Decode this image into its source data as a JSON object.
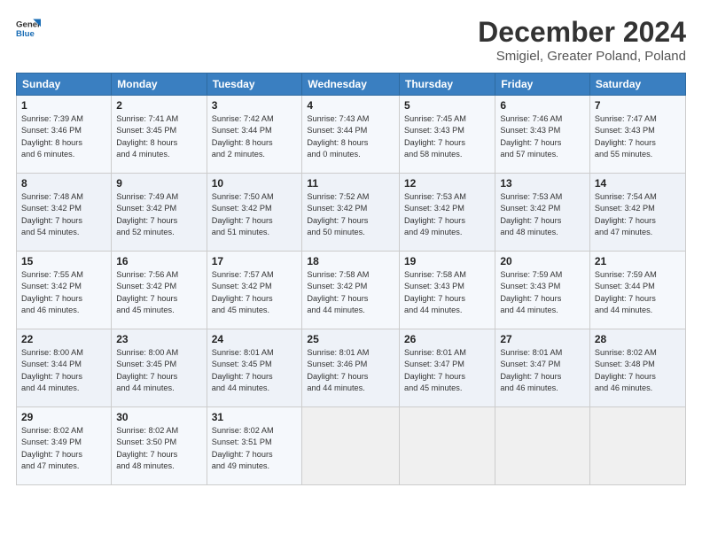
{
  "header": {
    "logo_line1": "General",
    "logo_line2": "Blue",
    "title": "December 2024",
    "subtitle": "Smigiel, Greater Poland, Poland"
  },
  "columns": [
    "Sunday",
    "Monday",
    "Tuesday",
    "Wednesday",
    "Thursday",
    "Friday",
    "Saturday"
  ],
  "weeks": [
    [
      {
        "day": "1",
        "info": "Sunrise: 7:39 AM\nSunset: 3:46 PM\nDaylight: 8 hours\nand 6 minutes."
      },
      {
        "day": "2",
        "info": "Sunrise: 7:41 AM\nSunset: 3:45 PM\nDaylight: 8 hours\nand 4 minutes."
      },
      {
        "day": "3",
        "info": "Sunrise: 7:42 AM\nSunset: 3:44 PM\nDaylight: 8 hours\nand 2 minutes."
      },
      {
        "day": "4",
        "info": "Sunrise: 7:43 AM\nSunset: 3:44 PM\nDaylight: 8 hours\nand 0 minutes."
      },
      {
        "day": "5",
        "info": "Sunrise: 7:45 AM\nSunset: 3:43 PM\nDaylight: 7 hours\nand 58 minutes."
      },
      {
        "day": "6",
        "info": "Sunrise: 7:46 AM\nSunset: 3:43 PM\nDaylight: 7 hours\nand 57 minutes."
      },
      {
        "day": "7",
        "info": "Sunrise: 7:47 AM\nSunset: 3:43 PM\nDaylight: 7 hours\nand 55 minutes."
      }
    ],
    [
      {
        "day": "8",
        "info": "Sunrise: 7:48 AM\nSunset: 3:42 PM\nDaylight: 7 hours\nand 54 minutes."
      },
      {
        "day": "9",
        "info": "Sunrise: 7:49 AM\nSunset: 3:42 PM\nDaylight: 7 hours\nand 52 minutes."
      },
      {
        "day": "10",
        "info": "Sunrise: 7:50 AM\nSunset: 3:42 PM\nDaylight: 7 hours\nand 51 minutes."
      },
      {
        "day": "11",
        "info": "Sunrise: 7:52 AM\nSunset: 3:42 PM\nDaylight: 7 hours\nand 50 minutes."
      },
      {
        "day": "12",
        "info": "Sunrise: 7:53 AM\nSunset: 3:42 PM\nDaylight: 7 hours\nand 49 minutes."
      },
      {
        "day": "13",
        "info": "Sunrise: 7:53 AM\nSunset: 3:42 PM\nDaylight: 7 hours\nand 48 minutes."
      },
      {
        "day": "14",
        "info": "Sunrise: 7:54 AM\nSunset: 3:42 PM\nDaylight: 7 hours\nand 47 minutes."
      }
    ],
    [
      {
        "day": "15",
        "info": "Sunrise: 7:55 AM\nSunset: 3:42 PM\nDaylight: 7 hours\nand 46 minutes."
      },
      {
        "day": "16",
        "info": "Sunrise: 7:56 AM\nSunset: 3:42 PM\nDaylight: 7 hours\nand 45 minutes."
      },
      {
        "day": "17",
        "info": "Sunrise: 7:57 AM\nSunset: 3:42 PM\nDaylight: 7 hours\nand 45 minutes."
      },
      {
        "day": "18",
        "info": "Sunrise: 7:58 AM\nSunset: 3:42 PM\nDaylight: 7 hours\nand 44 minutes."
      },
      {
        "day": "19",
        "info": "Sunrise: 7:58 AM\nSunset: 3:43 PM\nDaylight: 7 hours\nand 44 minutes."
      },
      {
        "day": "20",
        "info": "Sunrise: 7:59 AM\nSunset: 3:43 PM\nDaylight: 7 hours\nand 44 minutes."
      },
      {
        "day": "21",
        "info": "Sunrise: 7:59 AM\nSunset: 3:44 PM\nDaylight: 7 hours\nand 44 minutes."
      }
    ],
    [
      {
        "day": "22",
        "info": "Sunrise: 8:00 AM\nSunset: 3:44 PM\nDaylight: 7 hours\nand 44 minutes."
      },
      {
        "day": "23",
        "info": "Sunrise: 8:00 AM\nSunset: 3:45 PM\nDaylight: 7 hours\nand 44 minutes."
      },
      {
        "day": "24",
        "info": "Sunrise: 8:01 AM\nSunset: 3:45 PM\nDaylight: 7 hours\nand 44 minutes."
      },
      {
        "day": "25",
        "info": "Sunrise: 8:01 AM\nSunset: 3:46 PM\nDaylight: 7 hours\nand 44 minutes."
      },
      {
        "day": "26",
        "info": "Sunrise: 8:01 AM\nSunset: 3:47 PM\nDaylight: 7 hours\nand 45 minutes."
      },
      {
        "day": "27",
        "info": "Sunrise: 8:01 AM\nSunset: 3:47 PM\nDaylight: 7 hours\nand 46 minutes."
      },
      {
        "day": "28",
        "info": "Sunrise: 8:02 AM\nSunset: 3:48 PM\nDaylight: 7 hours\nand 46 minutes."
      }
    ],
    [
      {
        "day": "29",
        "info": "Sunrise: 8:02 AM\nSunset: 3:49 PM\nDaylight: 7 hours\nand 47 minutes."
      },
      {
        "day": "30",
        "info": "Sunrise: 8:02 AM\nSunset: 3:50 PM\nDaylight: 7 hours\nand 48 minutes."
      },
      {
        "day": "31",
        "info": "Sunrise: 8:02 AM\nSunset: 3:51 PM\nDaylight: 7 hours\nand 49 minutes."
      },
      null,
      null,
      null,
      null
    ]
  ]
}
